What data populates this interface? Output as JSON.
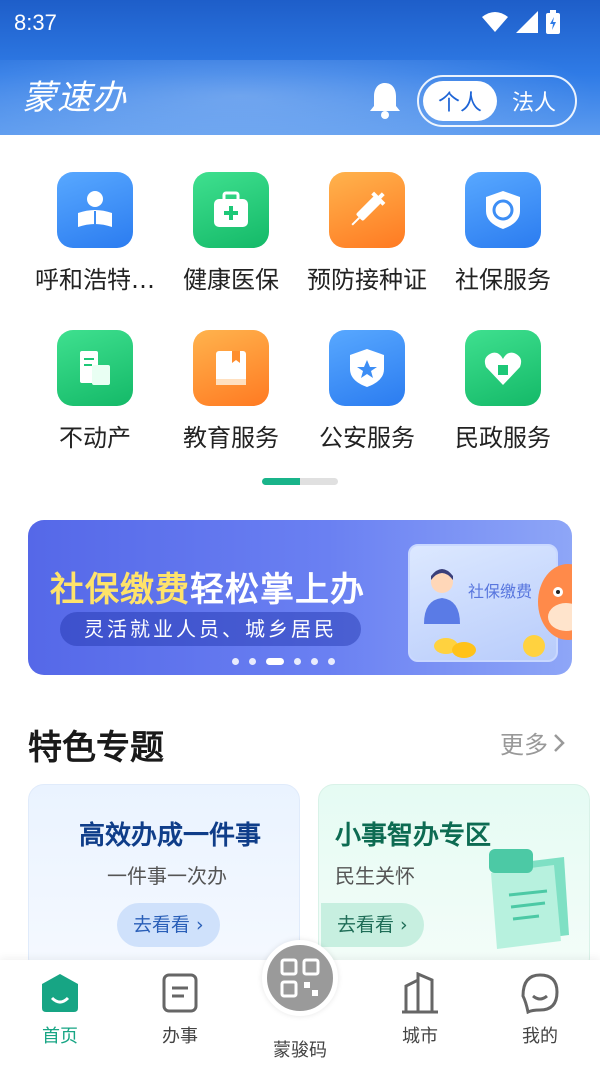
{
  "status_bar": {
    "time": "8:37"
  },
  "header": {
    "logo_text": "蒙速办",
    "toggle": {
      "personal": "个人",
      "legal": "法人"
    }
  },
  "services": [
    {
      "label": "呼和浩特…",
      "icon": "reading-person-icon",
      "color": "blue"
    },
    {
      "label": "健康医保",
      "icon": "medical-kit-icon",
      "color": "green"
    },
    {
      "label": "预防接种证",
      "icon": "syringe-icon",
      "color": "orange"
    },
    {
      "label": "社保服务",
      "icon": "social-security-shield-icon",
      "color": "blue"
    },
    {
      "label": "不动产",
      "icon": "property-document-icon",
      "color": "green"
    },
    {
      "label": "教育服务",
      "icon": "book-icon",
      "color": "orange"
    },
    {
      "label": "公安服务",
      "icon": "police-badge-icon",
      "color": "blue"
    },
    {
      "label": "民政服务",
      "icon": "heart-care-icon",
      "color": "green"
    }
  ],
  "banner": {
    "title_highlight": "社保缴费",
    "title_rest": "轻松掌上办",
    "subtitle": "灵活就业人员、城乡居民",
    "card_text": "社保缴费"
  },
  "featured": {
    "title": "特色专题",
    "more": "更多",
    "cards": [
      {
        "title": "高效办成一件事",
        "subtitle": "一件事一次办",
        "button": "去看看 ›"
      },
      {
        "title": "小事智办专区",
        "subtitle": "民生关怀",
        "button": "去看看 ›"
      }
    ]
  },
  "nav": {
    "home": "首页",
    "affairs": "办事",
    "code": "蒙骏码",
    "city": "城市",
    "mine": "我的"
  },
  "colors": {
    "header": "#2f7be6",
    "accent_green": "#17a584",
    "banner_highlight": "#ffe36a"
  }
}
